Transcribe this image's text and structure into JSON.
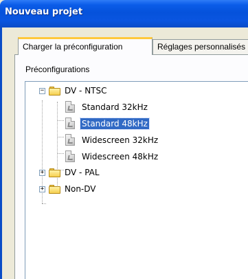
{
  "window": {
    "title": "Nouveau projet"
  },
  "tabs": [
    {
      "label": "Charger la préconfiguration",
      "active": true
    },
    {
      "label": "Réglages personnalisés",
      "active": false
    }
  ],
  "panel": {
    "group_label": "Préconfigurations"
  },
  "tree": {
    "folders": [
      {
        "label": "DV - NTSC",
        "expanded": true,
        "items": [
          {
            "label": "Standard 32kHz",
            "selected": false
          },
          {
            "label": "Standard 48kHz",
            "selected": true
          },
          {
            "label": "Widescreen 32kHz",
            "selected": false
          },
          {
            "label": "Widescreen 48kHz",
            "selected": false
          }
        ]
      },
      {
        "label": "DV - PAL",
        "expanded": false,
        "items": []
      },
      {
        "label": "Non-DV",
        "expanded": false,
        "items": []
      }
    ]
  },
  "colors": {
    "titlebar": "#0552db",
    "selection": "#316ac5",
    "active_tab_accent": "#ffc83c"
  }
}
